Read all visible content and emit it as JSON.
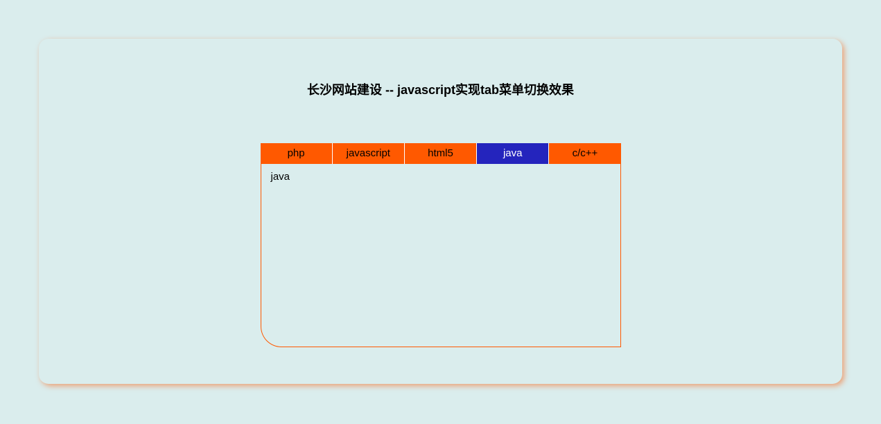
{
  "title": "长沙网站建设 -- javascript实现tab菜单切换效果",
  "tabs": {
    "items": [
      {
        "label": "php"
      },
      {
        "label": "javascript"
      },
      {
        "label": "html5"
      },
      {
        "label": "java"
      },
      {
        "label": "c/c++"
      }
    ],
    "activeIndex": 3
  },
  "content": "java"
}
